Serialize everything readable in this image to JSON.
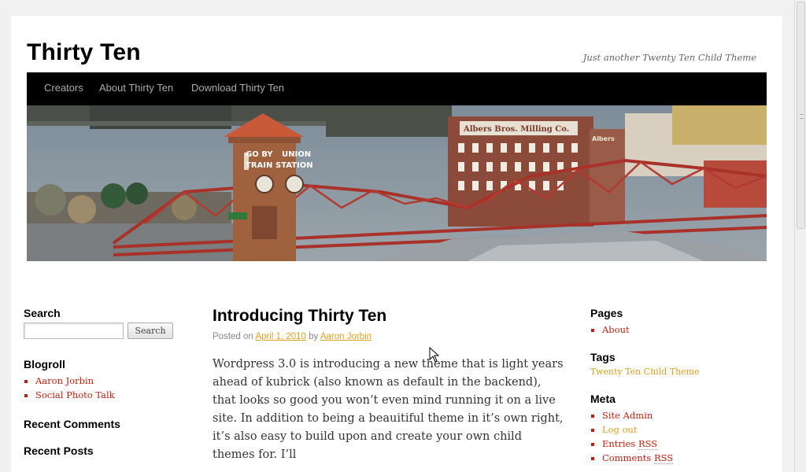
{
  "site": {
    "title": "Thirty Ten",
    "description": "Just another Twenty Ten Child Theme"
  },
  "menu": [
    {
      "label": "Creators"
    },
    {
      "label": "About Thirty Ten"
    },
    {
      "label": "Download Thirty Ten"
    }
  ],
  "header_image": {
    "sign_left_1": "GO BY",
    "sign_left_2": "TRAIN",
    "sign_right_1": "UNION",
    "sign_right_2": "STATION",
    "building_sign": "Albers Bros. Milling Co.",
    "building_sign_small": "Albers"
  },
  "left_sidebar": {
    "search_title": "Search",
    "search_value": "",
    "search_button": "Search",
    "blogroll_title": "Blogroll",
    "blogroll_items": [
      "Aaron Jorbin",
      "Social Photo Talk"
    ],
    "recent_comments_title": "Recent Comments",
    "recent_posts_title": "Recent Posts"
  },
  "post": {
    "title": "Introducing Thirty Ten",
    "posted_on": "Posted on",
    "date": "April 1, 2010",
    "by": "by",
    "author": "Aaron Jorbin",
    "content": "Wordpress 3.0 is introducing a new theme that is light years ahead of kubrick (also known as default in the backend), that looks so good you won’t even mind running it on a live site. In addition to being a beauitiful theme in it’s own right, it’s also easy to build upon and create your own child themes for. I’ll"
  },
  "right_sidebar": {
    "pages_title": "Pages",
    "pages_items": [
      "About"
    ],
    "tags_title": "Tags",
    "tag": "Twenty Ten Child Theme",
    "meta_title": "Meta",
    "meta_site_admin": "Site Admin",
    "meta_log_out": "Log out",
    "meta_entries": "Entries",
    "meta_comments": "Comments",
    "rss": "RSS"
  },
  "colors": {
    "link_red": "#c01f0f",
    "link_gold": "#e0a020",
    "menu_bg": "#000000",
    "page_bg": "#f1f1f1"
  }
}
